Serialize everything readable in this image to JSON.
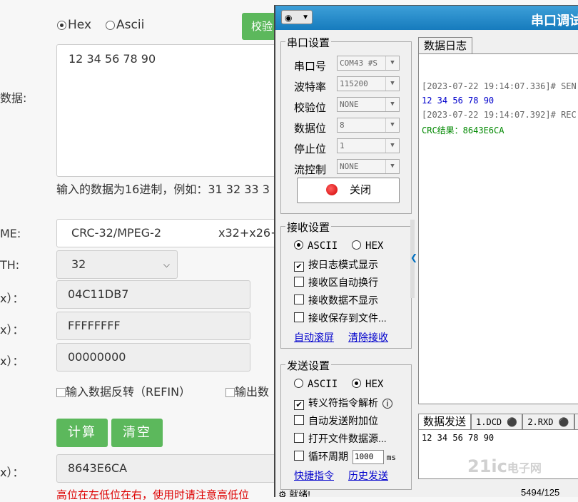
{
  "web": {
    "format_options": [
      {
        "label": "Hex",
        "selected": true
      },
      {
        "label": "Ascii",
        "selected": false
      }
    ],
    "verify_button": "校验",
    "data_label": "数据:",
    "data_value": "12 34 56 78 90",
    "hint": "输入的数据为16进制，例如：31 32 33 3",
    "name_label": "ME:",
    "algorithm": "CRC-32/MPEG-2",
    "polynomial_formula": "x32+x26+",
    "width_label": "TH:",
    "width_value": "32",
    "poly_label": "x）：",
    "poly_value": "04C11DB7",
    "init_label": "x）：",
    "init_value": "FFFFFFFF",
    "xorout_label": "x）：",
    "xorout_value": "00000000",
    "refin_label": "输入数据反转（REFIN）",
    "refout_label": "输出数",
    "calc_button": "计算",
    "clear_button": "清空",
    "result_label": "x）：",
    "result_value": "8643E6CA",
    "warning": "高位在左低位在右，使用时请注意高低位"
  },
  "app": {
    "title": "串口调试",
    "serial_group": {
      "title": "串口设置",
      "rows": [
        {
          "label": "串口号",
          "value": "COM43 #S"
        },
        {
          "label": "波特率",
          "value": "115200"
        },
        {
          "label": "校验位",
          "value": "NONE"
        },
        {
          "label": "数据位",
          "value": "8"
        },
        {
          "label": "停止位",
          "value": "1"
        },
        {
          "label": "流控制",
          "value": "NONE"
        }
      ],
      "close_button": "关闭"
    },
    "recv_group": {
      "title": "接收设置",
      "ascii_label": "ASCII",
      "hex_label": "HEX",
      "ascii_selected": true,
      "options": [
        {
          "label": "按日志模式显示",
          "checked": true
        },
        {
          "label": "接收区自动换行",
          "checked": false
        },
        {
          "label": "接收数据不显示",
          "checked": false
        },
        {
          "label": "接收保存到文件...",
          "checked": false
        }
      ],
      "link_autoscroll": "自动滚屏",
      "link_clear": "清除接收"
    },
    "send_group": {
      "title": "发送设置",
      "ascii_label": "ASCII",
      "hex_label": "HEX",
      "hex_selected": true,
      "options": [
        {
          "label": "转义符指令解析",
          "checked": true
        },
        {
          "label": "自动发送附加位",
          "checked": false
        },
        {
          "label": "打开文件数据源...",
          "checked": false
        },
        {
          "label": "循环周期",
          "checked": false
        }
      ],
      "period_value": "1000",
      "period_unit": "ms",
      "link_shortcut": "快捷指令",
      "link_history": "历史发送"
    },
    "log_tab": "数据日志",
    "log_lines": [
      {
        "text": "[2023-07-22 19:14:07.336]# SEN",
        "color": "#666666"
      },
      {
        "text": "12 34 56 78 90",
        "color": "#0000cc"
      },
      {
        "text": "[2023-07-22 19:14:07.392]# REC",
        "color": "#666666"
      },
      {
        "text": "CRC结果：8643E6CA",
        "color": "#008800"
      }
    ],
    "send_tabs": [
      "数据发送",
      "1.DCD",
      "2.RXD",
      "3"
    ],
    "send_text": "12 34 56 78 90",
    "status_text": "就绪!",
    "status_right": "5494/125"
  },
  "watermark": {
    "brand": "21ic",
    "cn": "电子网"
  }
}
